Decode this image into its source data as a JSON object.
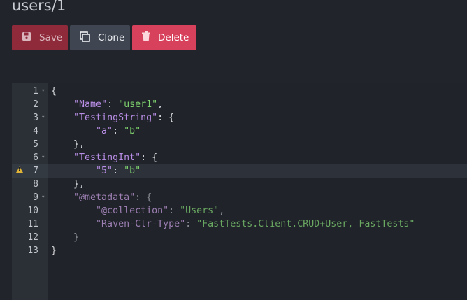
{
  "document": {
    "title": "users/1"
  },
  "toolbar": {
    "save_label": "Save",
    "clone_label": "Clone",
    "delete_label": "Delete"
  },
  "icons": {
    "save": "floppy-disk-icon",
    "clone": "copy-icon",
    "delete": "trash-icon",
    "fold": "fold-arrow-icon",
    "warning": "warning-icon"
  },
  "colors": {
    "save_bg": "#8f2a3a",
    "clone_bg": "#3f4651",
    "delete_bg": "#d7415b",
    "key": "#b98ee6",
    "string": "#7fd46f"
  },
  "editor": {
    "active_line": 7,
    "warning_line": 7,
    "lines": [
      {
        "n": "1",
        "fold": true,
        "parts": [
          [
            "p",
            "{"
          ]
        ]
      },
      {
        "n": "2",
        "fold": false,
        "parts": [
          [
            "p",
            "    "
          ],
          [
            "k",
            "\"Name\""
          ],
          [
            "p",
            ": "
          ],
          [
            "s",
            "\"user1\""
          ],
          [
            "p",
            ","
          ]
        ]
      },
      {
        "n": "3",
        "fold": true,
        "parts": [
          [
            "p",
            "    "
          ],
          [
            "k",
            "\"TestingString\""
          ],
          [
            "p",
            ": {"
          ]
        ]
      },
      {
        "n": "4",
        "fold": false,
        "parts": [
          [
            "p",
            "        "
          ],
          [
            "k",
            "\"a\""
          ],
          [
            "p",
            ": "
          ],
          [
            "s",
            "\"b\""
          ]
        ]
      },
      {
        "n": "5",
        "fold": false,
        "parts": [
          [
            "p",
            "    },"
          ]
        ]
      },
      {
        "n": "6",
        "fold": true,
        "parts": [
          [
            "p",
            "    "
          ],
          [
            "k",
            "\"TestingInt\""
          ],
          [
            "p",
            ": {"
          ]
        ]
      },
      {
        "n": "7",
        "fold": false,
        "parts": [
          [
            "p",
            "        "
          ],
          [
            "k",
            "\"5\""
          ],
          [
            "p",
            ": "
          ],
          [
            "s",
            "\"b\""
          ]
        ]
      },
      {
        "n": "8",
        "fold": false,
        "parts": [
          [
            "p",
            "    },"
          ]
        ]
      },
      {
        "n": "9",
        "fold": true,
        "parts": [
          [
            "pm",
            "    "
          ],
          [
            "km",
            "\"@metadata\""
          ],
          [
            "pm",
            ": {"
          ]
        ]
      },
      {
        "n": "10",
        "fold": false,
        "parts": [
          [
            "pm",
            "        "
          ],
          [
            "km",
            "\"@collection\""
          ],
          [
            "pm",
            ": "
          ],
          [
            "sm",
            "\"Users\""
          ],
          [
            "pm",
            ","
          ]
        ]
      },
      {
        "n": "11",
        "fold": false,
        "parts": [
          [
            "pm",
            "        "
          ],
          [
            "km",
            "\"Raven-Clr-Type\""
          ],
          [
            "pm",
            ": "
          ],
          [
            "sm",
            "\"FastTests.Client.CRUD+User, FastTests\""
          ]
        ]
      },
      {
        "n": "12",
        "fold": false,
        "parts": [
          [
            "pm",
            "    }"
          ]
        ]
      },
      {
        "n": "13",
        "fold": false,
        "parts": [
          [
            "p",
            "}"
          ]
        ]
      }
    ]
  }
}
